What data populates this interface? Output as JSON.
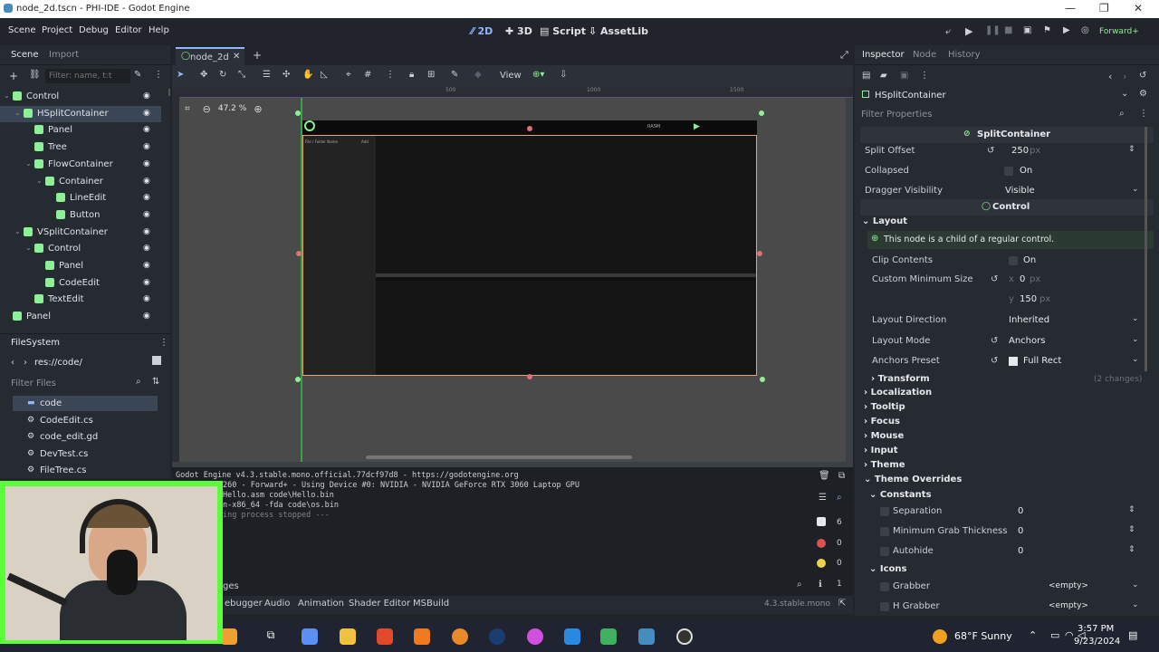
{
  "window": {
    "title": "node_2d.tscn - PHI-IDE - Godot Engine"
  },
  "menu": {
    "items": [
      "Scene",
      "Project",
      "Debug",
      "Editor",
      "Help"
    ]
  },
  "workspaces": {
    "items": [
      "2D",
      "3D",
      "Script",
      "AssetLib"
    ],
    "active": "2D"
  },
  "renderer": "Forward+",
  "left_dock": {
    "tabs": [
      "Scene",
      "Import"
    ],
    "filter_placeholder": "Filter: name, t:t",
    "tree": [
      {
        "label": "Control",
        "depth": 0,
        "color": "#8eef97",
        "selected": false
      },
      {
        "label": "HSplitContainer",
        "depth": 1,
        "color": "#8eef97",
        "selected": true
      },
      {
        "label": "Panel",
        "depth": 2,
        "color": "#8eef97",
        "selected": false
      },
      {
        "label": "Tree",
        "depth": 2,
        "color": "#8eef97",
        "selected": false
      },
      {
        "label": "FlowContainer",
        "depth": 2,
        "color": "#8eef97",
        "selected": false
      },
      {
        "label": "Container",
        "depth": 3,
        "color": "#8eef97",
        "selected": false
      },
      {
        "label": "LineEdit",
        "depth": 4,
        "color": "#8eef97",
        "selected": false
      },
      {
        "label": "Button",
        "depth": 4,
        "color": "#8eef97",
        "selected": false
      },
      {
        "label": "VSplitContainer",
        "depth": 1,
        "color": "#8eef97",
        "selected": false
      },
      {
        "label": "Control",
        "depth": 2,
        "color": "#8eef97",
        "selected": false
      },
      {
        "label": "Panel",
        "depth": 3,
        "color": "#8eef97",
        "selected": false
      },
      {
        "label": "CodeEdit",
        "depth": 3,
        "color": "#8eef97",
        "selected": false
      },
      {
        "label": "TextEdit",
        "depth": 2,
        "color": "#8eef97",
        "selected": false
      },
      {
        "label": "Panel",
        "depth": 0,
        "color": "#8eef97",
        "selected": false
      }
    ]
  },
  "filesystem": {
    "title": "FileSystem",
    "path": "res://code/",
    "filter_placeholder": "Filter Files",
    "items": [
      "code",
      "CodeEdit.cs",
      "code_edit.gd",
      "DevTest.cs",
      "FileTree.cs"
    ]
  },
  "editor_tab": {
    "label": "node_2d"
  },
  "toolbar2d": {
    "view_label": "View"
  },
  "viewport": {
    "zoom": "47.2 %",
    "ruler_marks": [
      "500",
      "1000",
      "1500"
    ],
    "mini_labels": [
      "File / Folder Name",
      "Add",
      "RASM"
    ]
  },
  "output": {
    "lines": [
      "Godot Engine v4.3.stable.mono.official.77dcf97d8 - https://godotengine.org",
      "260 - Forward+ - Using Device #0: NVIDIA - NVIDIA GeForce RTX 3060 Laptop GPU",
      "",
      "Hello.asm code\\Hello.bin",
      "n-x86_64 -fda code\\os.bin",
      "ing process stopped ---"
    ],
    "counts": {
      "messages": "6",
      "errors": "0",
      "warnings": "0",
      "info": "1"
    },
    "filter_label": "ges"
  },
  "bottom_tabs": {
    "items": [
      "ebugger",
      "Audio",
      "Animation",
      "Shader Editor",
      "MSBuild"
    ],
    "version": "4.3.stable.mono"
  },
  "inspector": {
    "tabs": [
      "Inspector",
      "Node",
      "History"
    ],
    "node_name": "HSplitContainer",
    "filter_placeholder": "Filter Properties",
    "split_section": "SplitContainer",
    "split_offset": {
      "label": "Split Offset",
      "value": "250",
      "unit": "px"
    },
    "collapsed": {
      "label": "Collapsed",
      "value": "On"
    },
    "dragger": {
      "label": "Dragger Visibility",
      "value": "Visible"
    },
    "control_section": "Control",
    "layout_label": "Layout",
    "child_note": "This node is a child of a regular control.",
    "clip": {
      "label": "Clip Contents",
      "value": "On"
    },
    "min_size": {
      "label": "Custom Minimum Size",
      "x_label": "x",
      "x": "0",
      "y_label": "y",
      "y": "150",
      "unit": "px"
    },
    "layout_direction": {
      "label": "Layout Direction",
      "value": "Inherited"
    },
    "layout_mode": {
      "label": "Layout Mode",
      "value": "Anchors"
    },
    "anchors_preset": {
      "label": "Anchors Preset",
      "value": "Full Rect"
    },
    "transform": {
      "label": "Transform",
      "note": "(2 changes)"
    },
    "categories": [
      "Localization",
      "Tooltip",
      "Focus",
      "Mouse",
      "Input",
      "Theme",
      "Theme Overrides"
    ],
    "constants_label": "Constants",
    "constants": [
      {
        "label": "Separation",
        "value": "0"
      },
      {
        "label": "Minimum Grab Thickness",
        "value": "0"
      },
      {
        "label": "Autohide",
        "value": "0"
      }
    ],
    "icons_label": "Icons",
    "icons": [
      {
        "label": "Grabber",
        "value": "<empty>"
      },
      {
        "label": "H Grabber",
        "value": "<empty>"
      }
    ]
  },
  "taskbar": {
    "weather": "68°F  Sunny",
    "time": "3:57 PM",
    "date": "9/23/2024"
  }
}
